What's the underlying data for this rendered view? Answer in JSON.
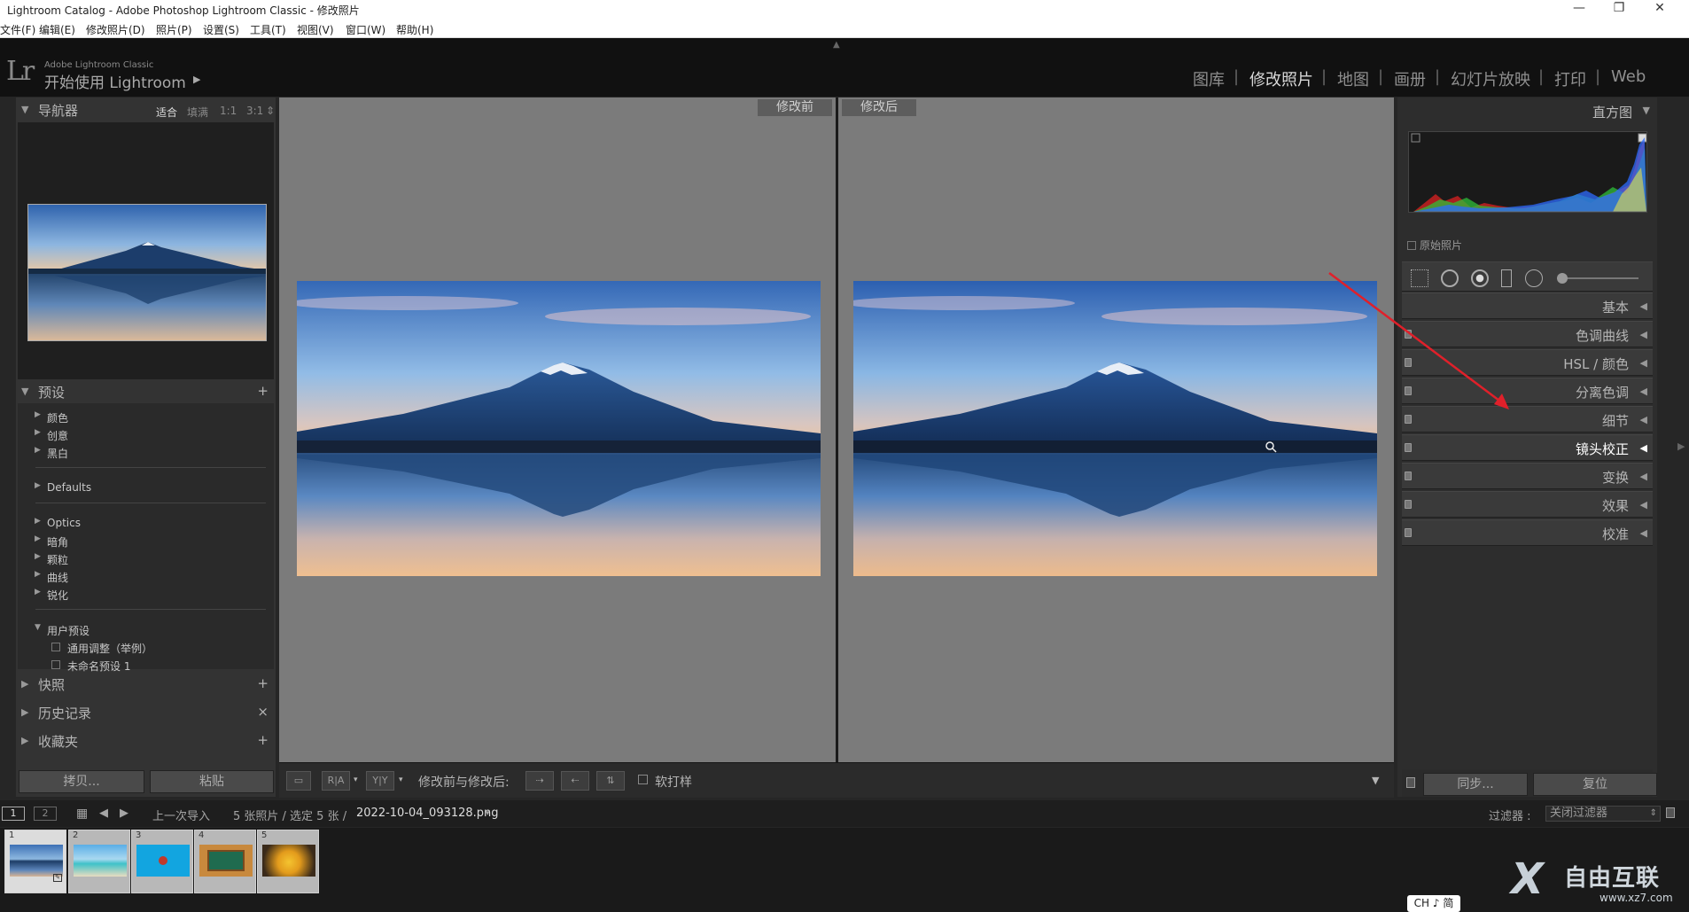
{
  "window": {
    "title": "Lightroom Catalog - Adobe Photoshop Lightroom Classic - 修改照片"
  },
  "menu": [
    "文件(F)",
    "编辑(E)",
    "修改照片(D)",
    "照片(P)",
    "设置(S)",
    "工具(T)",
    "视图(V)",
    "窗口(W)",
    "帮助(H)"
  ],
  "identity": {
    "logo": "Lr",
    "small": "Adobe Lightroom Classic",
    "big": "开始使用 Lightroom",
    "arrow": "▶"
  },
  "modules": {
    "items": [
      "图库",
      "修改照片",
      "地图",
      "画册",
      "幻灯片放映",
      "打印",
      "Web"
    ],
    "active": "修改照片"
  },
  "left": {
    "navigator": {
      "title": "导航器",
      "zoom": [
        "适合",
        "填满",
        "1:1",
        "3:1"
      ],
      "zoom_selected": "适合"
    },
    "presets": {
      "title": "预设",
      "add": "+",
      "groups": [
        "颜色",
        "创意",
        "黑白",
        "Defaults",
        "Optics",
        "暗角",
        "颗粒",
        "曲线",
        "锐化",
        "用户预设"
      ],
      "user_items": [
        "通用调整（举例）",
        "未命名预设 1"
      ]
    },
    "snapshots": {
      "title": "快照",
      "action": "+"
    },
    "history": {
      "title": "历史记录",
      "action": "×"
    },
    "collections": {
      "title": "收藏夹",
      "action": "+"
    },
    "copy_button": "拷贝...",
    "paste_button": "粘贴"
  },
  "center": {
    "before_label": "修改前",
    "after_label": "修改后"
  },
  "toolbar": {
    "view_btn1": "▭",
    "view_btn2": "R|A",
    "view_btn3": "Y|Y",
    "before_after_label": "修改前与修改后:",
    "proof_label": "软打样"
  },
  "right": {
    "histogram_title": "直方图",
    "original_photo": "原始照片",
    "sections": [
      "基本",
      "色调曲线",
      "HSL / 颜色",
      "分离色调",
      "细节",
      "镜头校正",
      "变换",
      "效果",
      "校准"
    ],
    "highlighted_section": "镜头校正",
    "sync_button": "同步...",
    "reset_button": "复位"
  },
  "filmstrip_bar": {
    "screen1": "1",
    "screen2": "2",
    "source": "上一次导入",
    "count": "5 张照片 / 选定 5 张 /",
    "filename": "2022-10-04_093128.png",
    "filter_label": "过滤器 :",
    "filter_value": "关闭过滤器"
  },
  "filmstrip": {
    "thumbs": [
      {
        "num": "1",
        "kind": "fuji"
      },
      {
        "num": "2",
        "kind": "beach"
      },
      {
        "num": "3",
        "kind": "blue"
      },
      {
        "num": "4",
        "kind": "board"
      },
      {
        "num": "5",
        "kind": "flower"
      }
    ]
  },
  "ime": "CH ♪ 简",
  "watermark": {
    "text": "自由互联",
    "url": "www.xz7.com"
  },
  "colors": {
    "annotation_arrow": "#e0202a",
    "panel_bg": "#333333",
    "canvas_bg": "#7b7b7b"
  }
}
